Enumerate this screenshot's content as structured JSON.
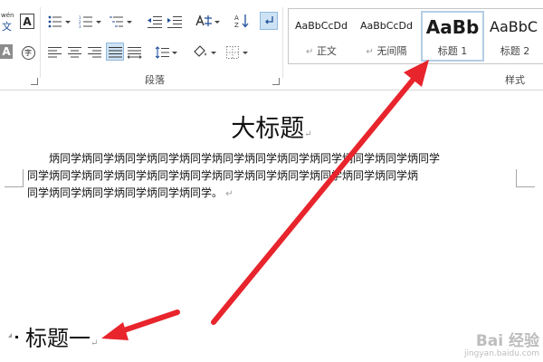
{
  "ribbon": {
    "paragraph_group_label": "段落",
    "styles_group_label": "样式",
    "phonetic_glyph": "wén",
    "phonetic_glyph_sub": "文",
    "char_border_glyph": "A",
    "char_shade_glyph": "A",
    "enclose_glyph": "字",
    "styles": [
      {
        "sample": "AaBbCcDd",
        "name": "正文",
        "mark": "↵"
      },
      {
        "sample": "AaBbCcDd",
        "name": "无间隔",
        "mark": "↵"
      },
      {
        "sample": "AaBb",
        "name": "标题 1",
        "mark": ""
      },
      {
        "sample": "AaBbC",
        "name": "标题 2",
        "mark": ""
      }
    ]
  },
  "document": {
    "big_title": "大标题",
    "para_line1": "炳同学炳同学炳同学炳同学炳同学炳同学炳同学炳同学炳同学炳同学炳同学炳同学",
    "para_line2": "同学炳同学炳同学炳同学炳同学炳同学炳同学炳同学炳同学炳同学炳同学炳同学炳",
    "para_line3": "同学炳同学炳同学炳同学炳同学炳同学。",
    "heading1": "标题一",
    "para_mark": "↵"
  },
  "colors": {
    "arrow": "#e8242c",
    "selected_style_border": "#b3cde6",
    "active_button": "#cde3f5"
  },
  "watermark": {
    "line1": "Bai 经验",
    "line2": "jingyan.baidu.com"
  }
}
